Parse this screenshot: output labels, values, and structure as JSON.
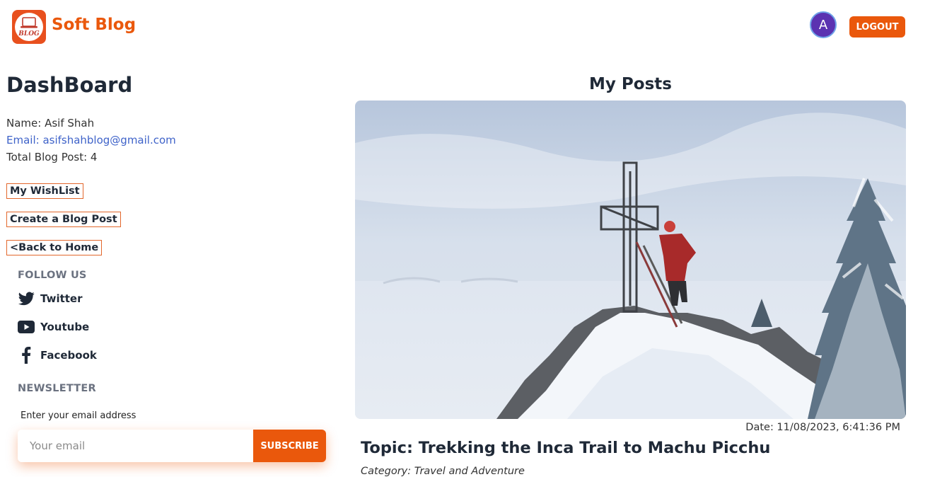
{
  "brand": {
    "name": "Soft Blog",
    "logo_text": "BLOG",
    "accent": "#ea580c"
  },
  "header": {
    "avatar_initial": "A",
    "logout_label": "LOGOUT"
  },
  "dashboard": {
    "title": "DashBoard",
    "name_line": "Name: Asif Shah",
    "email_line": "Email: asifshahblog@gmail.com",
    "total_line": "Total Blog Post: 4",
    "links": {
      "wishlist": "My WishList",
      "create": "Create a Blog Post",
      "back": "<Back to Home"
    }
  },
  "follow": {
    "heading": "FOLLOW US",
    "items": [
      {
        "label": "Twitter",
        "icon": "twitter-icon"
      },
      {
        "label": "Youtube",
        "icon": "youtube-icon"
      },
      {
        "label": "Facebook",
        "icon": "facebook-icon"
      }
    ]
  },
  "newsletter": {
    "heading": "NEWSLETTER",
    "prompt": "Enter your email address",
    "placeholder": "Your email",
    "button": "SUBSCRIBE"
  },
  "posts": {
    "title": "My Posts",
    "items": [
      {
        "date": "Date: 11/08/2023, 6:41:36 PM",
        "topic": "Topic: Trekking the Inca Trail to Machu Picchu",
        "category": "Category: Travel and Adventure"
      }
    ]
  }
}
